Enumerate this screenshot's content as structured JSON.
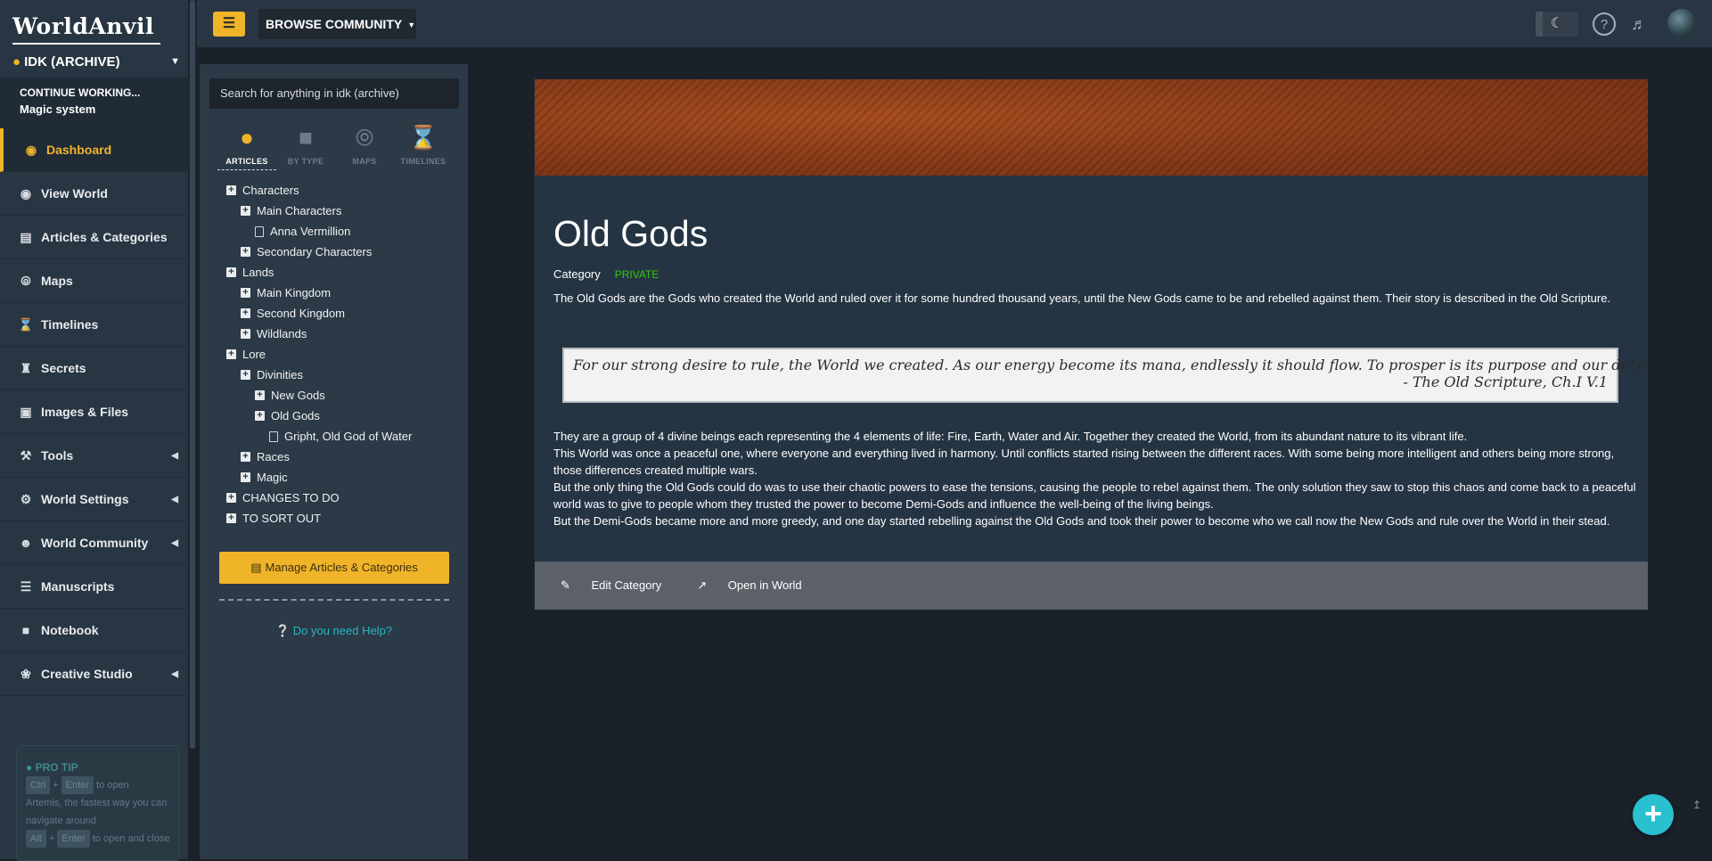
{
  "brand": {
    "logo": "WorldAnvil"
  },
  "world": {
    "name": "IDK (ARCHIVE)"
  },
  "continue": {
    "label": "CONTINUE WORKING...",
    "item": "Magic system"
  },
  "nav": [
    {
      "label": "Dashboard",
      "icon": "globe-icon"
    },
    {
      "label": "View World",
      "icon": "eye-icon"
    },
    {
      "label": "Articles & Categories",
      "icon": "sitemap-icon"
    },
    {
      "label": "Maps",
      "icon": "compass-icon"
    },
    {
      "label": "Timelines",
      "icon": "hourglass-icon"
    },
    {
      "label": "Secrets",
      "icon": "chess-rook-icon"
    },
    {
      "label": "Images & Files",
      "icon": "image-icon"
    },
    {
      "label": "Tools",
      "icon": "hammer-icon"
    },
    {
      "label": "World Settings",
      "icon": "gear-icon"
    },
    {
      "label": "World Community",
      "icon": "users-icon"
    },
    {
      "label": "Manuscripts",
      "icon": "books-icon"
    },
    {
      "label": "Notebook",
      "icon": "notebook-icon"
    },
    {
      "label": "Creative Studio",
      "icon": "palette-icon"
    }
  ],
  "protip": {
    "title": "PRO TIP",
    "key1": "Ctrl",
    "key2": "Enter",
    "text1": "to open",
    "text2": "Artemis, the fastest way you can navigate around",
    "key3": "Alt",
    "key4": "Enter",
    "text3": "to open and close"
  },
  "topbar": {
    "browse_label": "BROWSE COMMUNITY"
  },
  "tree_panel": {
    "search_placeholder": "Search for anything in idk (archive)",
    "tabs": [
      "ARTICLES",
      "BY TYPE",
      "MAPS",
      "TIMELINES"
    ],
    "nodes": [
      {
        "label": "Characters",
        "level": 0,
        "kind": "folder"
      },
      {
        "label": "Main Characters",
        "level": 1,
        "kind": "folder"
      },
      {
        "label": "Anna Vermillion",
        "level": 2,
        "kind": "doc"
      },
      {
        "label": "Secondary Characters",
        "level": 1,
        "kind": "folder"
      },
      {
        "label": "Lands",
        "level": 0,
        "kind": "folder"
      },
      {
        "label": "Main Kingdom",
        "level": 1,
        "kind": "folder"
      },
      {
        "label": "Second Kingdom",
        "level": 1,
        "kind": "folder"
      },
      {
        "label": "Wildlands",
        "level": 1,
        "kind": "folder"
      },
      {
        "label": "Lore",
        "level": 0,
        "kind": "folder"
      },
      {
        "label": "Divinities",
        "level": 1,
        "kind": "folder"
      },
      {
        "label": "New Gods",
        "level": 2,
        "kind": "folder"
      },
      {
        "label": "Old Gods",
        "level": 2,
        "kind": "folder"
      },
      {
        "label": "Gripht, Old God of Water",
        "level": 3,
        "kind": "doc"
      },
      {
        "label": "Races",
        "level": 1,
        "kind": "folder"
      },
      {
        "label": "Magic",
        "level": 1,
        "kind": "folder"
      },
      {
        "label": "CHANGES TO DO",
        "level": 0,
        "kind": "folder"
      },
      {
        "label": "TO SORT OUT",
        "level": 0,
        "kind": "folder"
      }
    ],
    "manage_label": "Manage Articles & Categories",
    "help_label": "Do you need Help?"
  },
  "article": {
    "title": "Old Gods",
    "category_label": "Category",
    "status": "PRIVATE",
    "intro": "The Old Gods are the Gods who created the World and ruled over it for some hundred thousand years, until the New Gods came to be and rebelled against them. Their story is described in the Old Scripture.",
    "quote": "For our strong desire to rule, the World we created. As our energy become its mana, endlessly it should flow. To prosper is its purpose and our duty.",
    "quote_cite": "- The Old Scripture, Ch.I V.1",
    "paragraphs": [
      "They are a group of 4 divine beings each representing the 4 elements of life: Fire, Earth, Water and Air. Together they created the World, from its abundant nature to its vibrant life.",
      "This World was once a peaceful one, where everyone and everything lived in harmony. Until conflicts started rising between the different races. With some being more intelligent and others being more strong, those differences created multiple wars.",
      "But the only thing the Old Gods could do was to use their chaotic powers to ease the tensions, causing the people to rebel against them. The only solution they saw to stop this chaos and come back to a peaceful world was to give to people whom they trusted the power to become Demi-Gods and influence the well-being of the living beings.",
      "But the Demi-Gods became more and more greedy, and one day started rebelling against the Old Gods and took their power to become who we call now the New Gods and rule over the World in their stead."
    ],
    "edit_label": "Edit Category",
    "open_label": "Open in World"
  }
}
